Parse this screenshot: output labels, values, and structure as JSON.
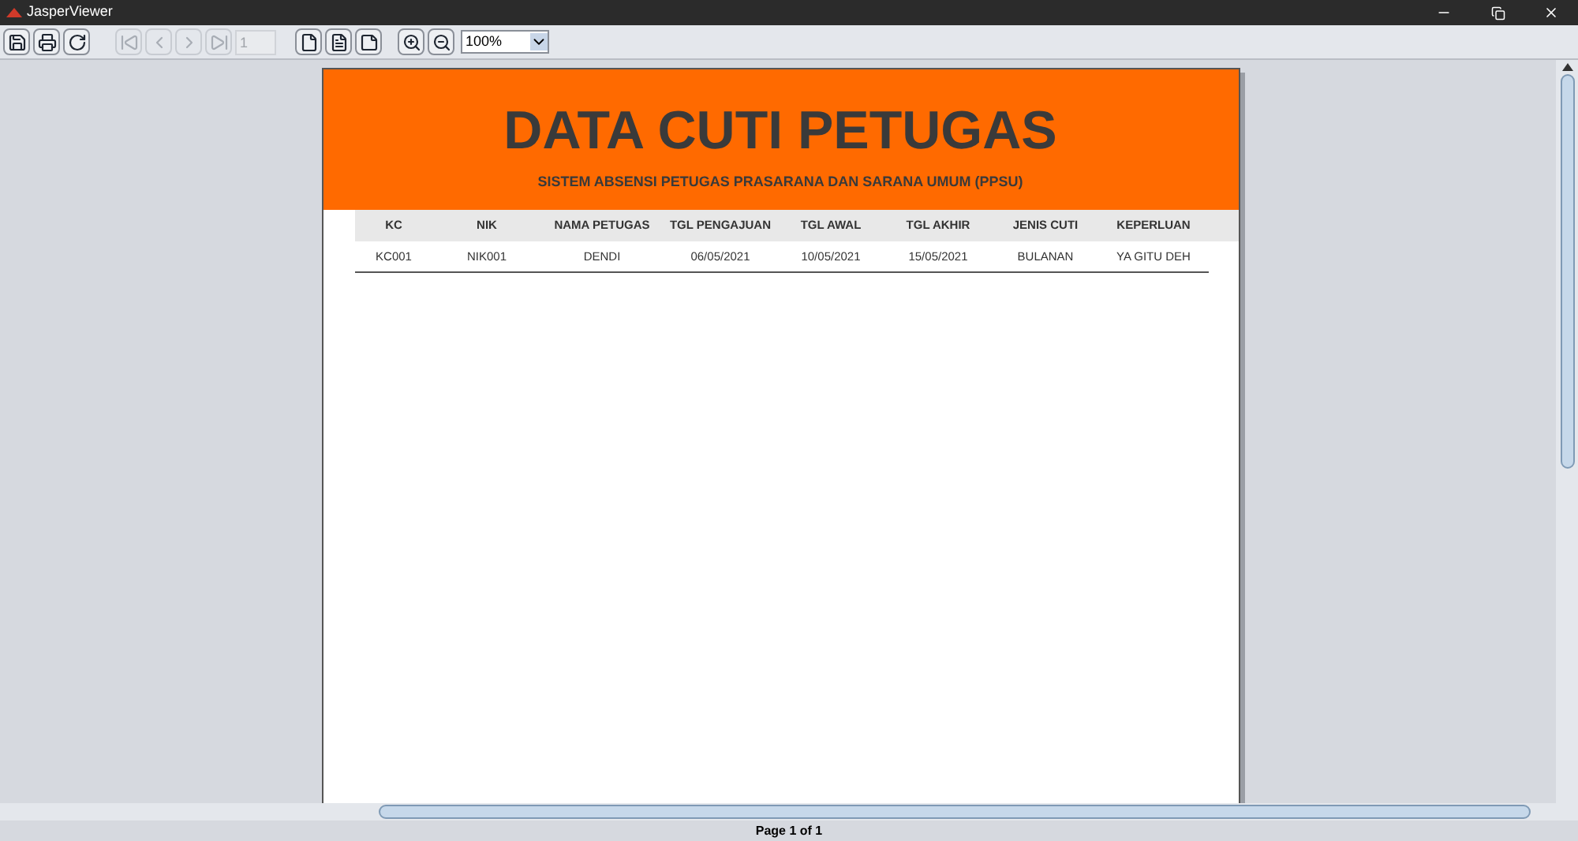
{
  "window": {
    "title": "JasperViewer"
  },
  "toolbar": {
    "buttons": [
      {
        "kind": "save",
        "disabled": false
      },
      {
        "kind": "print",
        "disabled": false
      },
      {
        "kind": "reload",
        "disabled": false
      },
      {
        "kind": "first",
        "disabled": true
      },
      {
        "kind": "previous",
        "disabled": true
      },
      {
        "kind": "next",
        "disabled": true
      },
      {
        "kind": "last",
        "disabled": true
      }
    ],
    "page_field": {
      "value": "1",
      "disabled": true
    },
    "view_buttons": [
      {
        "kind": "actual-size"
      },
      {
        "kind": "fit-page"
      },
      {
        "kind": "fit-width"
      },
      {
        "kind": "zoom-in"
      },
      {
        "kind": "zoom-out"
      }
    ],
    "zoom": {
      "value": "100%"
    }
  },
  "report": {
    "title": "DATA CUTI PETUGAS",
    "subtitle": "SISTEM ABSENSI PETUGAS PRASARANA DAN SARANA UMUM (PPSU)",
    "columns": [
      "KC",
      "NIK",
      "NAMA PETUGAS",
      "TGL PENGAJUAN",
      "TGL AWAL",
      "TGL AKHIR",
      "JENIS CUTI",
      "KEPERLUAN"
    ],
    "rows": [
      [
        "KC001",
        "NIK001",
        "DENDI",
        "06/05/2021",
        "10/05/2021",
        "15/05/2021",
        "BULANAN",
        "YA GITU DEH"
      ]
    ]
  },
  "status_bar": {
    "text": "Page 1 of 1"
  }
}
